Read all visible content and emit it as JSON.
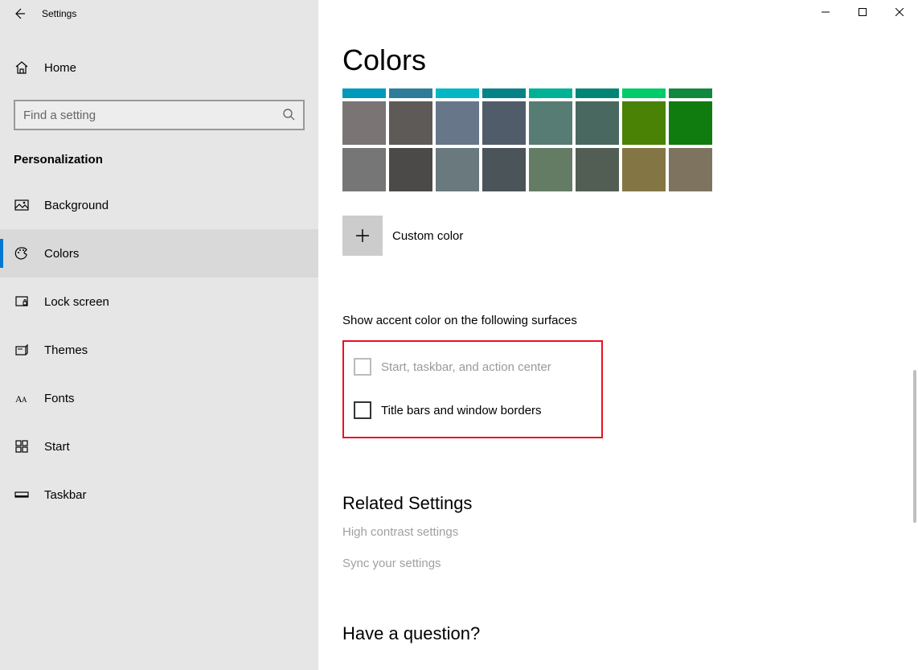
{
  "app_title": "Settings",
  "home_label": "Home",
  "search_placeholder": "Find a setting",
  "category": "Personalization",
  "nav": [
    {
      "label": "Background"
    },
    {
      "label": "Colors"
    },
    {
      "label": "Lock screen"
    },
    {
      "label": "Themes"
    },
    {
      "label": "Fonts"
    },
    {
      "label": "Start"
    },
    {
      "label": "Taskbar"
    }
  ],
  "page_title": "Colors",
  "color_strip": [
    "#0099bc",
    "#2d7d9a",
    "#00b7c3",
    "#038387",
    "#00b294",
    "#018574",
    "#00cc6a",
    "#10893e"
  ],
  "color_row2": [
    "#7a7574",
    "#5d5a58",
    "#68768a",
    "#515c6b",
    "#567c73",
    "#486860",
    "#498205",
    "#107c10"
  ],
  "color_row3": [
    "#767676",
    "#4c4a48",
    "#69797e",
    "#4a5459",
    "#647c64",
    "#525e54",
    "#847545",
    "#7e735f"
  ],
  "custom_color_label": "Custom color",
  "accent_heading": "Show accent color on the following surfaces",
  "checkbox1_label": "Start, taskbar, and action center",
  "checkbox2_label": "Title bars and window borders",
  "related_heading": "Related Settings",
  "related_links": [
    "High contrast settings",
    "Sync your settings"
  ],
  "question_heading": "Have a question?"
}
